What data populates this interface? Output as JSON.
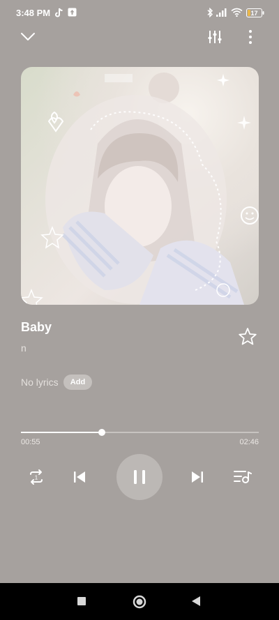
{
  "status_bar": {
    "time": "3:48 PM",
    "battery": "17",
    "icons": [
      "tiktok-icon",
      "upload-icon",
      "bluetooth-icon",
      "signal-icon",
      "wifi-icon",
      "battery-icon"
    ]
  },
  "top_bar": {
    "icons": [
      "collapse-chevron-icon",
      "equalizer-icon",
      "more-vertical-icon"
    ]
  },
  "track": {
    "title": "Baby",
    "artist": "n"
  },
  "lyrics": {
    "text": "No lyrics",
    "add_label": "Add"
  },
  "progress": {
    "current": "00:55",
    "total": "02:46",
    "fraction": 0.339
  },
  "controls": {
    "icons": [
      "repeat-one-icon",
      "previous-icon",
      "pause-icon",
      "next-icon",
      "playlist-icon"
    ]
  },
  "colors": {
    "background": "#a6a19e",
    "play_button": "#bcb8b5",
    "nav_bar": "#000000"
  }
}
